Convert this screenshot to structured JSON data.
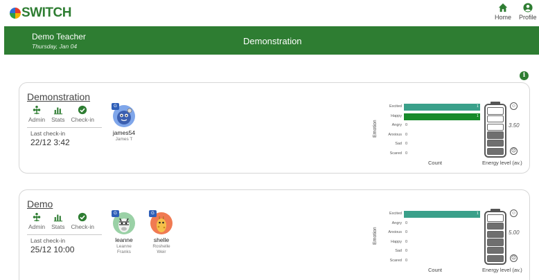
{
  "app": {
    "logo_text": "SWITCH",
    "colors": {
      "primary": "#2e7d32",
      "bar_teal": "#3aa08a",
      "bar_green": "#178a2a",
      "battery": "#6f6f6f"
    }
  },
  "nav": {
    "home_label": "Home",
    "profile_label": "Profile",
    "home_icon": "home-icon",
    "profile_icon": "profile-icon"
  },
  "banner": {
    "user": "Demo Teacher",
    "date": "Thursday, Jan 04",
    "title": "Demonstration"
  },
  "info_icon_glyph": "i",
  "classes": [
    {
      "title": "Demonstration",
      "actions": {
        "admin": "Admin",
        "stats": "Stats",
        "checkin": "Check-in"
      },
      "last_checkin_label": "Last check-in",
      "last_checkin_value": "22/12 3:42",
      "students": [
        {
          "username": "james54",
          "name": "James T",
          "avatar_color": "#7fa6ea",
          "badge": "G"
        }
      ],
      "emotion_chart": {
        "axis_title": "Emotion",
        "xlabel": "Count",
        "rows": [
          {
            "label": "Excited",
            "value": 1,
            "value_text": "1",
            "color": "#3aa08a"
          },
          {
            "label": "Happy",
            "value": 1,
            "value_text": "1",
            "color": "#178a2a"
          },
          {
            "label": "Angry",
            "value": 0,
            "value_text": "0"
          },
          {
            "label": "Anxious",
            "value": 0,
            "value_text": "0"
          },
          {
            "label": "Sad",
            "value": 0,
            "value_text": "0"
          },
          {
            "label": "Scared",
            "value": 0,
            "value_text": "0"
          }
        ]
      },
      "energy": {
        "value": "3.50",
        "level": 0.5,
        "label": "Energy level (av.)"
      }
    },
    {
      "title": "Demo",
      "actions": {
        "admin": "Admin",
        "stats": "Stats",
        "checkin": "Check-in"
      },
      "last_checkin_label": "Last check-in",
      "last_checkin_value": "25/12 10:00",
      "students": [
        {
          "username": "leanne",
          "name": "Leanne Franks",
          "name_line1": "Leanne",
          "name_line2": "Franks",
          "avatar_color": "#9ad1a6",
          "badge": "G"
        },
        {
          "username": "shelle",
          "name": "Roshelle Weir",
          "name_line1": "Roshelle",
          "name_line2": "Weir",
          "avatar_color": "#f07a52",
          "badge": "G"
        }
      ],
      "emotion_chart": {
        "axis_title": "Emotion",
        "xlabel": "Count",
        "rows": [
          {
            "label": "Excited",
            "value": 1,
            "value_text": "1",
            "color": "#3aa08a"
          },
          {
            "label": "Angry",
            "value": 0,
            "value_text": "0"
          },
          {
            "label": "Anxious",
            "value": 0,
            "value_text": "0"
          },
          {
            "label": "Happy",
            "value": 0,
            "value_text": "0"
          },
          {
            "label": "Sad",
            "value": 0,
            "value_text": "0"
          },
          {
            "label": "Scared",
            "value": 0,
            "value_text": "0"
          }
        ]
      },
      "energy": {
        "value": "5.00",
        "level": 0.88,
        "label": "Energy level (av.)"
      }
    }
  ]
}
